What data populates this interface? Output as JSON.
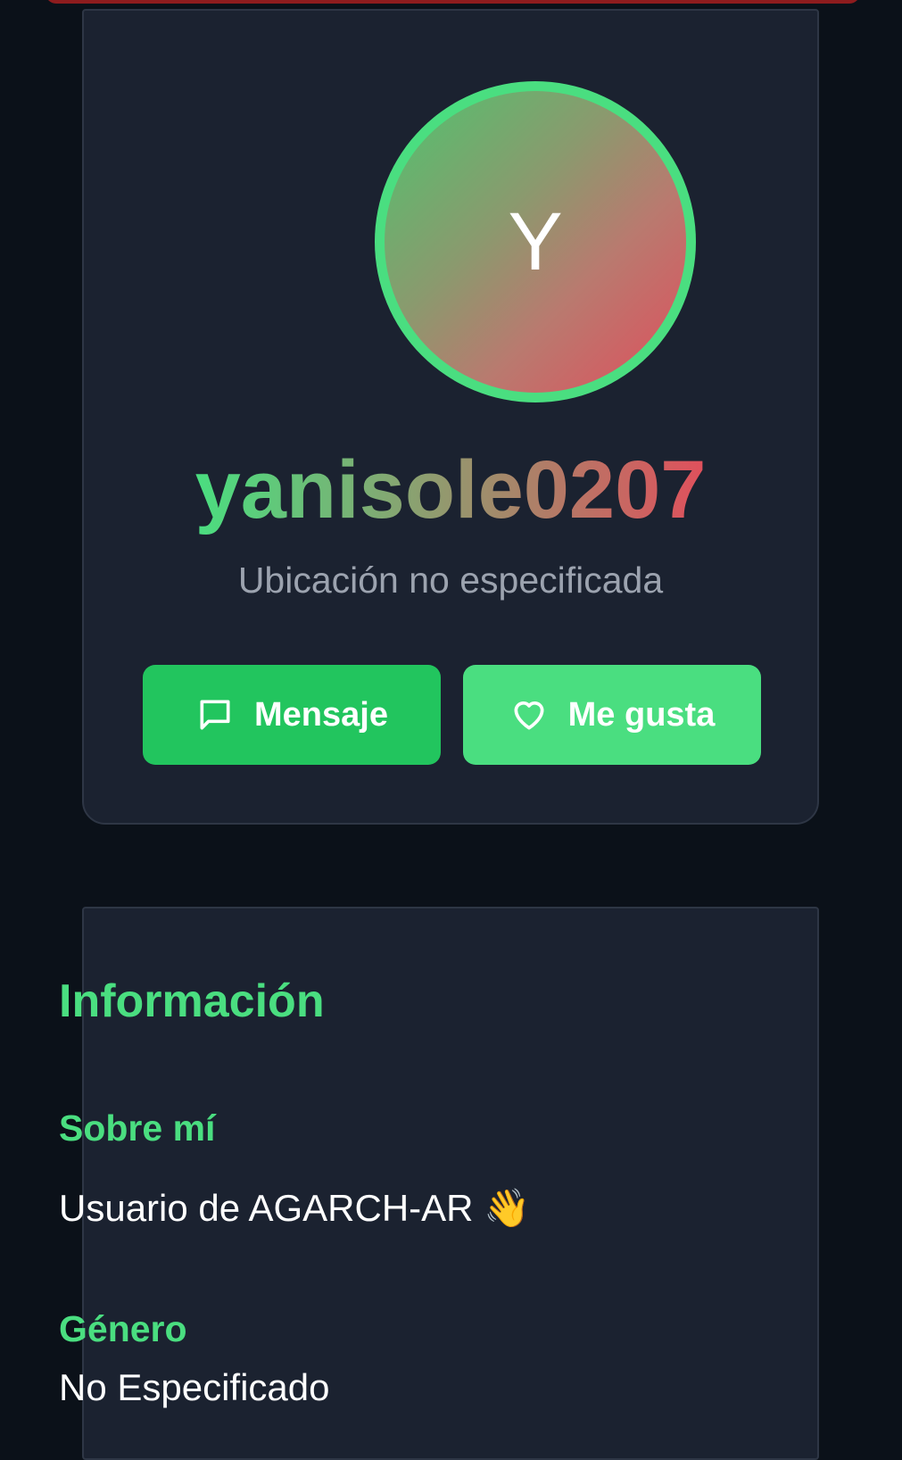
{
  "profile": {
    "avatar_initial": "Y",
    "username": "yanisole0207",
    "location": "Ubicación no especificada",
    "colors": {
      "accent": "#4ade80",
      "gradient_end": "#e0505c",
      "alert_bar": "#8e1c1e"
    }
  },
  "actions": {
    "message_label": "Mensaje",
    "message_icon": "chat-bubble-icon",
    "like_label": "Me gusta",
    "like_icon": "heart-icon"
  },
  "info": {
    "title": "Información",
    "about_label": "Sobre mí",
    "about_value": "Usuario de AGARCH-AR 👋",
    "gender_label": "Género",
    "gender_value": "No Especificado"
  }
}
